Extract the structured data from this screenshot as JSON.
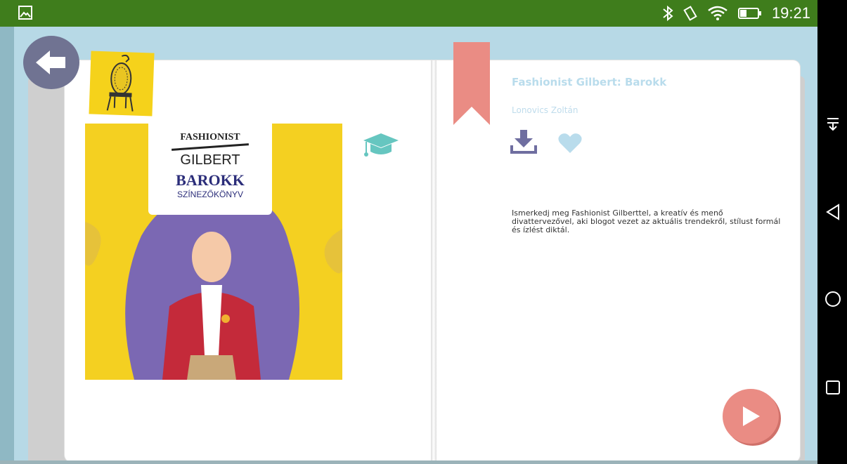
{
  "status_bar": {
    "time": "19:21"
  },
  "book": {
    "title": "Fashionist Gilbert: Barokk",
    "author": "Lonovics Zoltán",
    "description": "Ismerkedj meg Fashionist Gilberttel, a kreatív és menő divattervezővel, aki blogot vezet az aktuális trendekről, stílust formál és ízlést diktál.",
    "cover": {
      "brand": "FASHIONIST",
      "name": "GILBERT",
      "title": "BAROKK",
      "subtitle": "SZÍNEZŐKÖNYV"
    }
  },
  "colors": {
    "status_bar": "#3f7d1c",
    "background": "#b7d9e6",
    "back_button": "#707392",
    "accent_yellow": "#f5d21b",
    "bookmark": "#ea8c84",
    "play_button": "#ea8c84",
    "icon_purple": "#6f6ea0",
    "icon_light_blue": "#b9dcec",
    "cap_teal": "#66c6c0"
  },
  "icons": {
    "status_left": "image-icon",
    "status_right": [
      "bluetooth-icon",
      "vibrate-icon",
      "wifi-icon",
      "battery-icon"
    ],
    "nav": [
      "collapse-icon",
      "back-triangle-icon",
      "home-circle-icon",
      "recents-square-icon"
    ]
  }
}
